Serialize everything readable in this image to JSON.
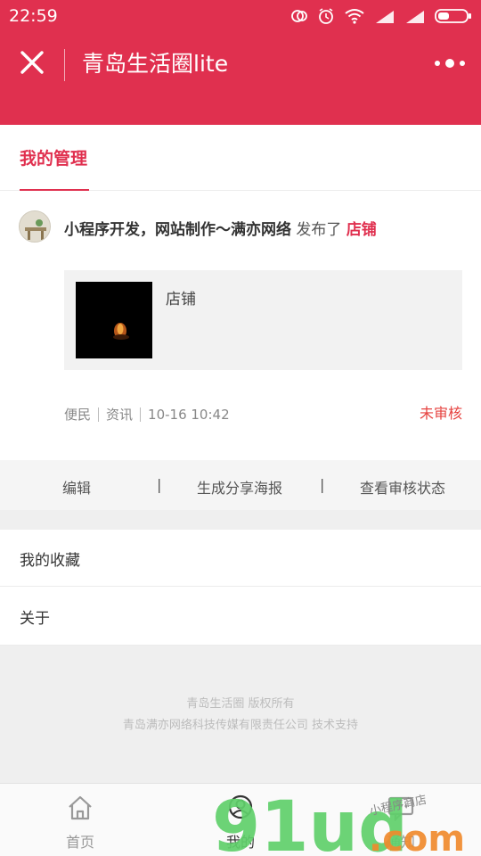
{
  "status_bar": {
    "time": "22:59"
  },
  "nav": {
    "title": "青岛生活圈lite",
    "close_icon": "close-icon",
    "more_icon": "more-dots-icon"
  },
  "tabs": {
    "active_label": "我的管理"
  },
  "post": {
    "author": "小程序开发，网站制作～满亦网络",
    "action_text": " 发布了 ",
    "type": "店铺",
    "card_title": "店铺",
    "category": "便民",
    "subcategory": "资讯",
    "time": "10-16 10:42",
    "review_status": "未审核"
  },
  "actions": {
    "edit": "编辑",
    "share_poster": "生成分享海报",
    "view_status": "查看审核状态",
    "separator": "|"
  },
  "menu": {
    "favorites": "我的收藏",
    "about": "关于"
  },
  "footer": {
    "copyright": "青岛生活圈 版权所有",
    "support": "青岛满亦网络科技传媒有限责任公司 技术支持"
  },
  "tabbar": {
    "home": "首页",
    "mine": "我的",
    "notice": "通知"
  },
  "watermark": {
    "main": "91ud",
    "suffix": ".com",
    "tag": "小程序商店"
  },
  "colors": {
    "brand": "#e0304f",
    "warning": "#e64340"
  }
}
